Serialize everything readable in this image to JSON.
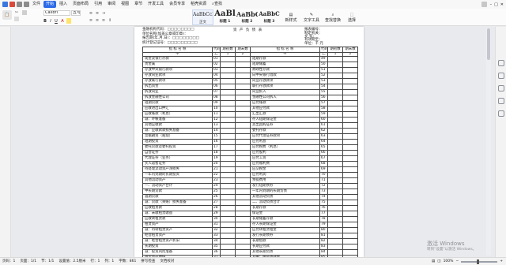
{
  "menubar": {
    "items": [
      "文件",
      "开始",
      "插入",
      "页面布局",
      "引用",
      "审阅",
      "视图",
      "章节",
      "开发工具",
      "会员专享",
      "稻壳资源"
    ],
    "active": "开始",
    "search": "查找"
  },
  "ribbon": {
    "font_name": "Calibri",
    "font_size": "五号",
    "styles": [
      {
        "preview": "AaBbCcDd",
        "label": "正文"
      },
      {
        "preview": "AaBl",
        "label": "标题 1"
      },
      {
        "preview": "AaBbC",
        "label": "标题 2"
      },
      {
        "preview": "AaBbC",
        "label": "标题 3"
      }
    ],
    "new_style": "新样式",
    "text_tools": "文字工具",
    "find_replace": "查找替换",
    "select": "选择"
  },
  "document": {
    "title": "资 产 负 债 表",
    "header_left": [
      "金融机构代码：□□□□□□□□",
      "单位名称(加盖公章或印章)：",
      "报告期(年.月.日)：□□□□□□□□",
      "统计登记证号：□□□□□□□□□"
    ],
    "header_right": [
      "报表编号：",
      "制定机关：",
      "文 号：",
      "有效期至：",
      "单位：千 元"
    ],
    "columns": [
      "指 标 名 称",
      "代码",
      "期初数",
      "期末数",
      "指 标 名 称",
      "代码",
      "期初数",
      "期末数"
    ],
    "sub": [
      "甲",
      "乙",
      "1",
      "2",
      "甲",
      "乙",
      "1",
      "2"
    ],
    "left_rows": [
      [
        "现金及银行存款",
        "01"
      ],
      [
        "贵金属",
        "02"
      ],
      [
        "存放中央银行款项",
        "03"
      ],
      [
        "存放同业款项",
        "04"
      ],
      [
        "存放联行款项",
        "05"
      ],
      [
        "拆出资金",
        "06"
      ],
      [
        "拆放同业",
        "07"
      ],
      [
        "拆放金融性公司",
        "08"
      ],
      [
        "短期贷款",
        "09"
      ],
      [
        "应收进出口押汇",
        "10"
      ],
      [
        "应收账款（利息）",
        "11"
      ],
      [
        "减：坏帐准备",
        "12"
      ],
      [
        "其他应收款",
        "13"
      ],
      [
        "减：应收款款损失准备",
        "14"
      ],
      [
        "票据融资（贴现）",
        "15"
      ],
      [
        "短期投资",
        "16"
      ],
      [
        "委托贷款及委托投资",
        "17"
      ],
      [
        "自营证券",
        "18"
      ],
      [
        "代理证券（业务）",
        "19"
      ],
      [
        "买入返售证券",
        "20"
      ],
      [
        "待处理流动资产净损失",
        "21"
      ],
      [
        "一年内到期的长期投资",
        "22"
      ],
      [
        "其他流动资产",
        "23"
      ],
      [
        "一、流动资产合计",
        "24"
      ],
      [
        "中长期贷款",
        "25"
      ],
      [
        "逾期贷款",
        "26"
      ],
      [
        "减：贷款（呆账）损失准备",
        "27"
      ],
      [
        "应收租赁款",
        "28"
      ],
      [
        "减：未收租赁收益",
        "29"
      ],
      [
        "应收转租赁款",
        "30"
      ],
      [
        "租赁资产",
        "31"
      ],
      [
        "减：待转租赁资产",
        "32"
      ],
      [
        "经营租赁资产",
        "33"
      ],
      [
        "减：经营租赁资产折旧",
        "34"
      ],
      [
        "长期投资",
        "35"
      ],
      [
        "减：投资风险准备",
        "36"
      ],
      [
        "固定资产原值",
        "37"
      ]
    ],
    "right_rows": [
      [
        "短期存款",
        "49"
      ],
      [
        "短期储蓄",
        "50"
      ],
      [
        "财政性存款",
        "51"
      ],
      [
        "向中央银行借款",
        "52"
      ],
      [
        "同业存放款项",
        "53"
      ],
      [
        "联行存放款项",
        "54"
      ],
      [
        "同业拆入",
        "55"
      ],
      [
        "金融性公司拆入",
        "56"
      ],
      [
        "应付账款",
        "57"
      ],
      [
        "其他应付款",
        "58"
      ],
      [
        "汇出汇款",
        "59"
      ],
      [
        "存入短期保证金",
        "60"
      ],
      [
        "卖出回购证券",
        "61"
      ],
      [
        "委托存款",
        "62"
      ],
      [
        "应付代理证券款项",
        "63"
      ],
      [
        "应付利息",
        "64"
      ],
      [
        "应付税费（利息）",
        "65"
      ],
      [
        "应付股利",
        "66"
      ],
      [
        "应付工资",
        "67"
      ],
      [
        "应付福利费",
        "68"
      ],
      [
        "应交税金",
        "69"
      ],
      [
        "应付利润",
        "70"
      ],
      [
        "预提费用",
        "71"
      ],
      [
        "发行短期债券",
        "72"
      ],
      [
        "一年内到期的长期负债",
        "73"
      ],
      [
        "其他流动负债",
        "74"
      ],
      [
        "二、流动负债合计",
        "75"
      ],
      [
        "长期存款",
        "76"
      ],
      [
        "保证金",
        "77"
      ],
      [
        "长期储蓄存款",
        "78"
      ],
      [
        "存入长期保证金",
        "79"
      ],
      [
        "应付转租赁租金",
        "80"
      ],
      [
        "发行长期债券",
        "81"
      ],
      [
        "长期借款",
        "82"
      ],
      [
        "长期应付款",
        "83"
      ],
      [
        "其他长期负债",
        "84"
      ],
      [
        "其中：住房周转金",
        "85"
      ]
    ]
  },
  "status": {
    "page": "页码：1",
    "pages": "页面：1/1",
    "section": "节：1/1",
    "settings": "设置值：2.5厘米",
    "row": "行：1",
    "col": "列：1",
    "words": "字数：861",
    "spell": "拼写检查",
    "protect": "文档校对",
    "zoom": "100%"
  },
  "watermark": {
    "line1": "激活 Windows",
    "line2": "转到“设置”以激活 Windows。"
  }
}
